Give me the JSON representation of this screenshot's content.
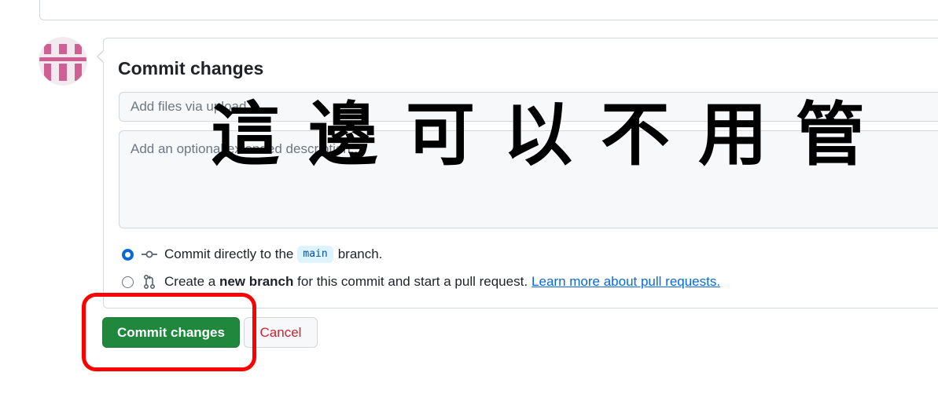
{
  "panel": {
    "title": "Commit changes",
    "summary_placeholder": "Add files via upload",
    "description_placeholder": "Add an optional extended description..."
  },
  "options": {
    "direct": {
      "checked": true,
      "text_before": "Commit directly to the",
      "branch": "main",
      "text_after": "branch."
    },
    "new_branch": {
      "checked": false,
      "text_before": "Create a",
      "bold": "new branch",
      "text_after": "for this commit and start a pull request.",
      "link": "Learn more about pull requests."
    }
  },
  "buttons": {
    "commit_label": "Commit changes",
    "cancel_label": "Cancel"
  },
  "annotation": {
    "overlay_text": "這邊可以不用管"
  },
  "colors": {
    "commit_green": "#1f883d",
    "cancel_red": "#cf222e",
    "link_blue": "#0969da",
    "annotation_red": "#ff0000",
    "avatar_pink": "#d05f93"
  },
  "icons": {
    "commit_icon": "git-commit-icon",
    "pr_icon": "git-pull-request-icon",
    "avatar": "identicon-avatar"
  }
}
